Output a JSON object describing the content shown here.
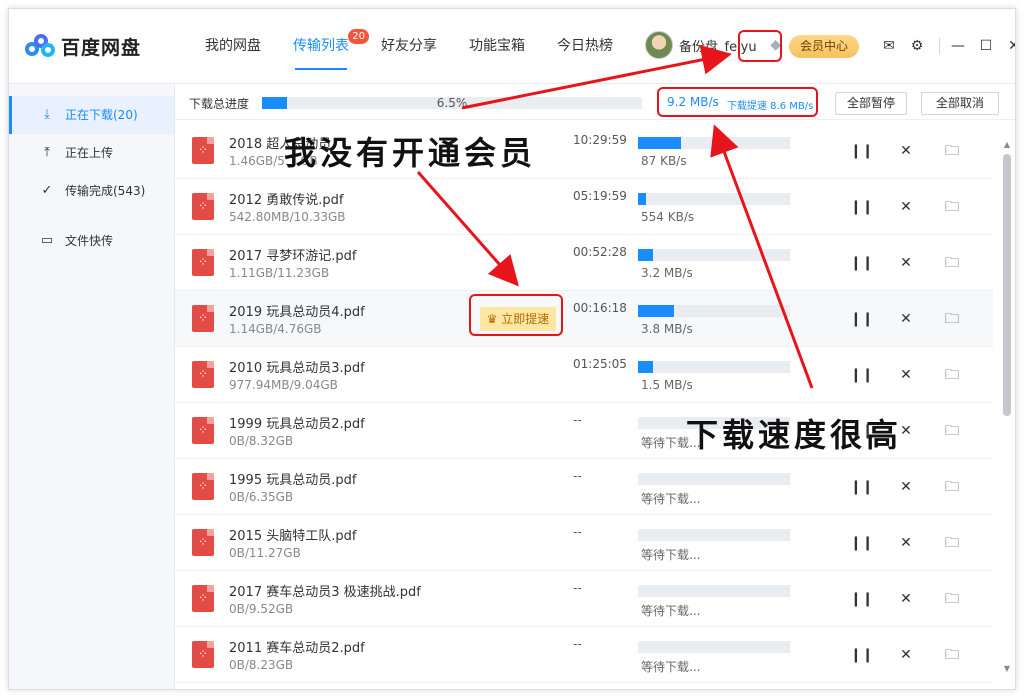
{
  "app": {
    "logo_text": "百度网盘"
  },
  "nav": [
    {
      "label": "我的网盘"
    },
    {
      "label": "传输列表",
      "badge": "20"
    },
    {
      "label": "好友分享"
    },
    {
      "label": "功能宝箱"
    },
    {
      "label": "今日热榜"
    }
  ],
  "user": {
    "name": "备份盘_feiyu",
    "vip_label": "会员中心"
  },
  "sidebar": [
    {
      "label": "正在下载(20)",
      "icon": "download-icon"
    },
    {
      "label": "正在上传",
      "icon": "upload-icon"
    },
    {
      "label": "传输完成(543)",
      "icon": "check-circle-icon"
    },
    {
      "label": "文件快传",
      "icon": "monitor-icon"
    }
  ],
  "totals": {
    "label": "下载总进度",
    "percent_text": "6.5%",
    "progress": 0.065,
    "speed": "9.2 MB/s",
    "boost_speed": "下载提速 8.6 MB/s",
    "pause_all": "全部暂停",
    "cancel_all": "全部取消"
  },
  "files": [
    {
      "name": "2018 超人总动员",
      "size": "1.46GB/5.1 GB",
      "time": "10:29:59",
      "progress": 0.28,
      "speed": "87 KB/s"
    },
    {
      "name": "2012 勇敢传说.pdf",
      "size": "542.80MB/10.33GB",
      "time": "05:19:59",
      "progress": 0.05,
      "speed": "554 KB/s"
    },
    {
      "name": "2017 寻梦环游记.pdf",
      "size": "1.11GB/11.23GB",
      "time": "00:52:28",
      "progress": 0.1,
      "speed": "3.2 MB/s"
    },
    {
      "name": "2019 玩具总动员4.pdf",
      "size": "1.14GB/4.76GB",
      "time": "00:16:18",
      "progress": 0.24,
      "speed": "3.8 MB/s",
      "boost": "立即提速"
    },
    {
      "name": "2010 玩具总动员3.pdf",
      "size": "977.94MB/9.04GB",
      "time": "01:25:05",
      "progress": 0.1,
      "speed": "1.5 MB/s"
    },
    {
      "name": "1999 玩具总动员2.pdf",
      "size": "0B/8.32GB",
      "time": "--",
      "progress": 0,
      "speed": "等待下载..."
    },
    {
      "name": "1995 玩具总动员.pdf",
      "size": "0B/6.35GB",
      "time": "--",
      "progress": 0,
      "speed": "等待下载..."
    },
    {
      "name": "2015 头脑特工队.pdf",
      "size": "0B/11.27GB",
      "time": "--",
      "progress": 0,
      "speed": "等待下载..."
    },
    {
      "name": "2017 赛车总动员3 极速挑战.pdf",
      "size": "0B/9.52GB",
      "time": "--",
      "progress": 0,
      "speed": "等待下载..."
    },
    {
      "name": "2011 赛车总动员2.pdf",
      "size": "0B/8.23GB",
      "time": "--",
      "progress": 0,
      "speed": "等待下载..."
    }
  ],
  "annotations": {
    "no_vip": "我没有开通会员",
    "fast_speed": "下载速度很高"
  },
  "colors": {
    "accent": "#1a8cff",
    "annotation": "#e8141b"
  }
}
